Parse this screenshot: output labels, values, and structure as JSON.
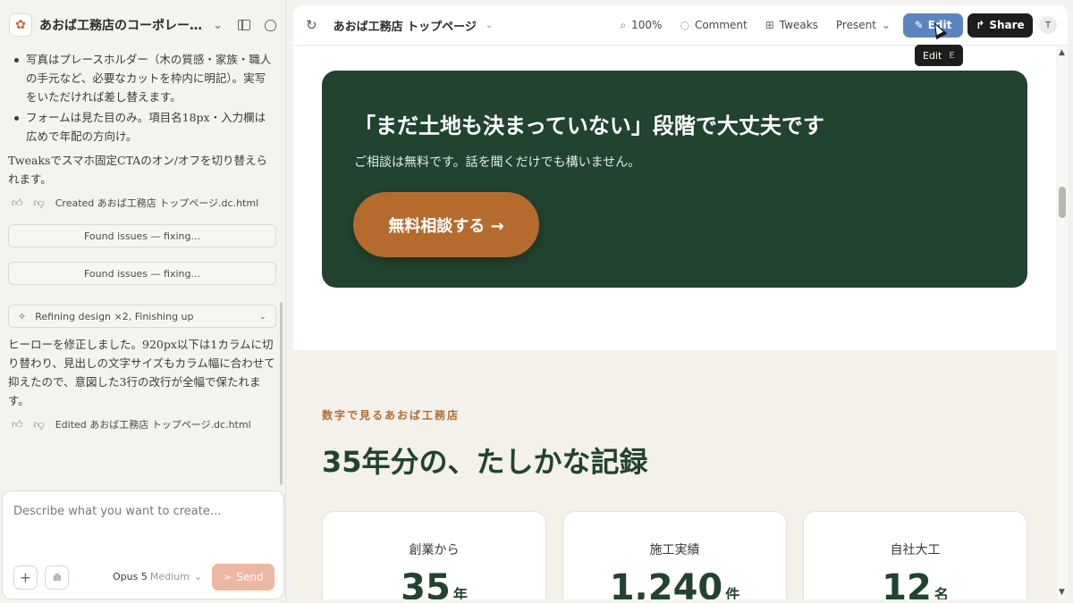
{
  "app": {
    "project_title": "あおば工務店のコーポレート…",
    "page_name": "あおば工務店 トップページ"
  },
  "chat": {
    "bullets": [
      "写真はプレースホルダー（木の質感・家族・職人の手元など、必要なカットを枠内に明記）。実写をいただければ差し替えます。",
      "フォームは見た目のみ。項目名18px・入力欄は広めで年配の方向け。"
    ],
    "tweaks_note": "Tweaksでスマホ固定CTAのオン/オフを切り替えられます。",
    "created_label": "Created あおば工務店 トップページ.dc.html",
    "found_issues_1": "Found issues — fixing...",
    "found_issues_2": "Found issues — fixing...",
    "refining_label": "Refining design ×2, Finishing up",
    "hero_note": "ヒーローを修正しました。920px以下は1カラムに切り替わり、見出しの文字サイズもカラム幅に合わせて抑えたので、意図した3行の改行が全幅で保たれます。",
    "edited_label": "Edited あおば工務店 トップページ.dc.html"
  },
  "composer": {
    "placeholder": "Describe what you want to create...",
    "model": "Opus 5",
    "level": "Medium",
    "send_label": "Send"
  },
  "toolbar": {
    "zoom": "100%",
    "comment": "Comment",
    "tweaks": "Tweaks",
    "present": "Present",
    "edit": "Edit",
    "share": "Share",
    "avatar_initial": "T"
  },
  "tooltip": {
    "label": "Edit",
    "shortcut": "E"
  },
  "canvas": {
    "cta": {
      "heading": "「まだ土地も決まっていない」段階で大丈夫です",
      "subtext": "ご相談は無料です。話を聞くだけでも構いません。",
      "button": "無料相談する →"
    },
    "stats": {
      "eyebrow": "数字で見るあおば工務店",
      "heading": "35年分の、たしかな記録",
      "cards": [
        {
          "label": "創業から",
          "value": "35",
          "unit": "年"
        },
        {
          "label": "施工実績",
          "value": "1,240",
          "unit": "件"
        },
        {
          "label": "自社大工",
          "value": "12",
          "unit": "名"
        }
      ]
    }
  },
  "colors": {
    "cta_bg": "#21432f",
    "accent": "#b56b2e",
    "edit_button": "#5b86bd",
    "send_button": "#eeb7a4"
  },
  "icons": [
    "palette-logo-icon",
    "chevron-down-icon",
    "sidebar-toggle-icon",
    "notification-icon",
    "reload-icon",
    "zoom-icon",
    "comment-icon",
    "tweaks-icon",
    "pencil-icon",
    "share-icon",
    "plus-icon",
    "waveform-icon",
    "send-icon",
    "thumbs-up-icon",
    "thumbs-down-icon",
    "sparkle-icon"
  ]
}
